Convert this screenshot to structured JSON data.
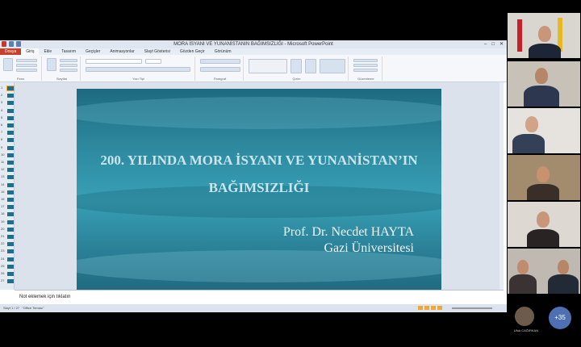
{
  "window": {
    "title": "MORA İSYANI VE YUNANİSTANIN BAĞIMSIZLIĞI  -  Microsoft PowerPoint"
  },
  "ribbon": {
    "tabs": [
      "Dosya",
      "Giriş",
      "Ekle",
      "Tasarım",
      "Geçişler",
      "Animasyonlar",
      "Slayt Gösterisi",
      "Gözden Geçir",
      "Görünüm"
    ],
    "groups": [
      "Pano",
      "Slaytlar",
      "Yazı Tipi",
      "Paragraf",
      "Çizim",
      "Düzenleme"
    ]
  },
  "slide_panel": {
    "numbers": [
      "1",
      "2",
      "3",
      "4",
      "5",
      "6",
      "7",
      "8",
      "9",
      "10",
      "11",
      "12",
      "13",
      "14",
      "15",
      "16",
      "17",
      "18",
      "19",
      "20",
      "21",
      "22",
      "23",
      "24",
      "25",
      "26",
      "27"
    ]
  },
  "slide": {
    "title": "200. YILINDA MORA İSYANI VE YUNANİSTAN’IN BAĞIMSIZLIĞI",
    "author_line1": "Prof. Dr. Necdet HAYTA",
    "author_line2": "Gazi Üniversitesi"
  },
  "notes": {
    "placeholder": "Not eklemek için tıklatın"
  },
  "statusbar": {
    "slide_info": "Slayt 1 / 27",
    "theme": "\"Office Teması\""
  },
  "participants": {
    "more_count": "+35",
    "small_name": "Ufuk CAĞIRKAN"
  },
  "colors": {
    "file_tab": "#c6402a",
    "slide_bg": "#2e8aa0",
    "title_text": "#c9e6ef",
    "badge": "#4f6fb3"
  }
}
